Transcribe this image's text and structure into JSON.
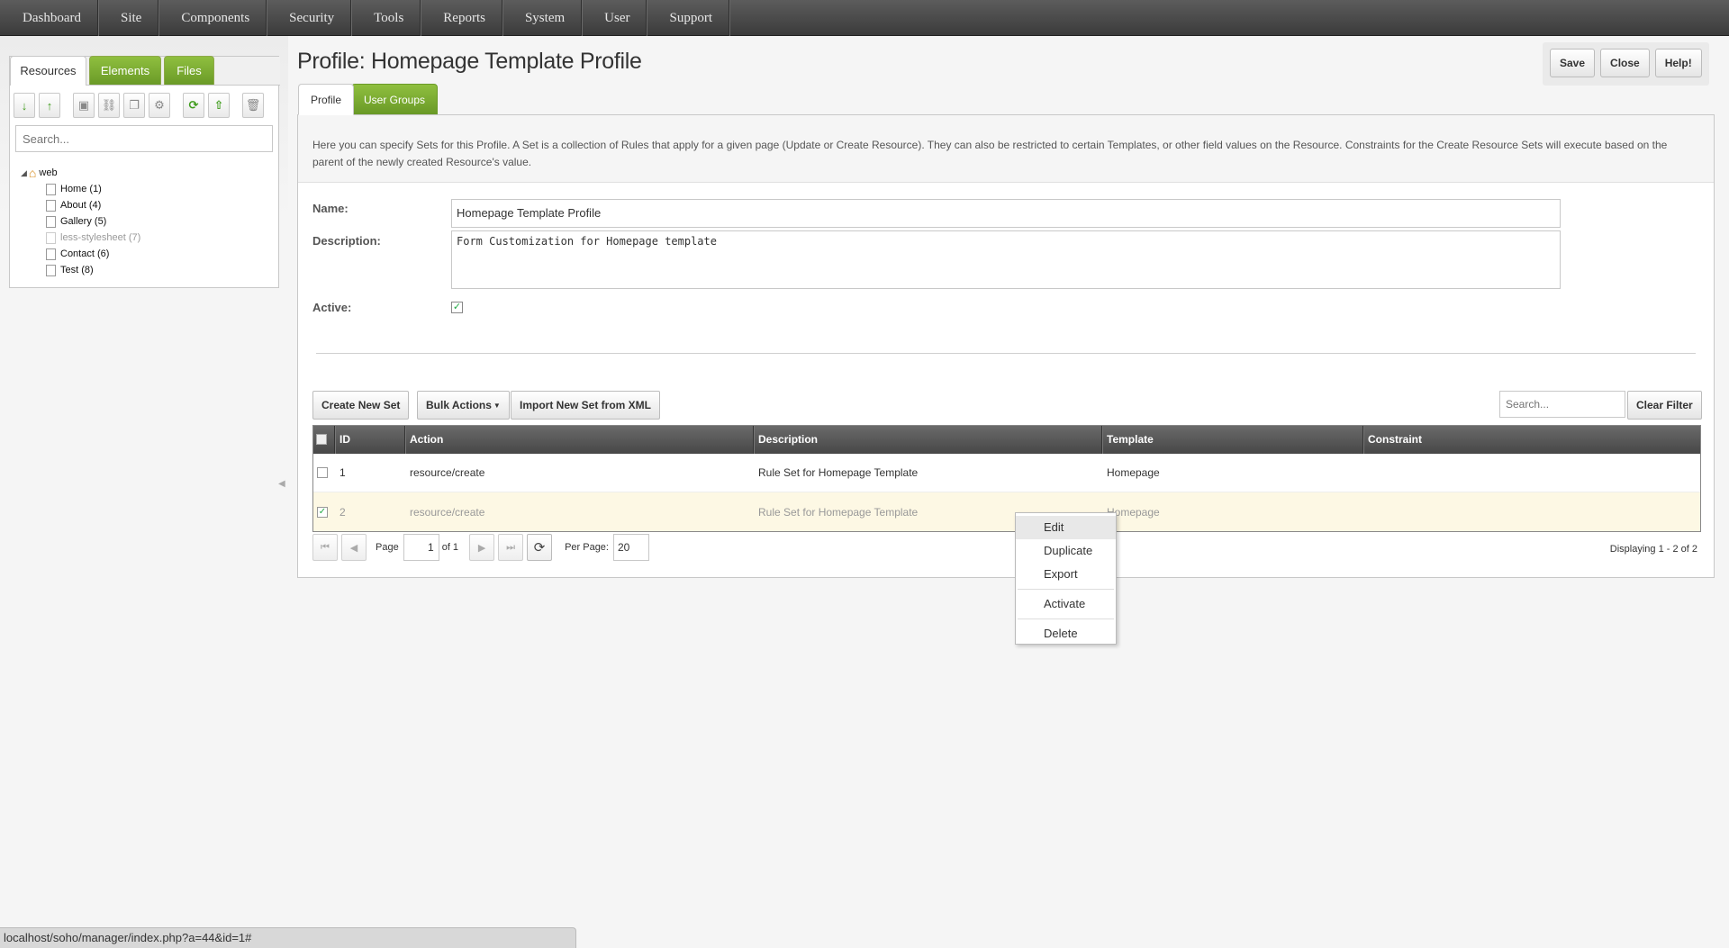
{
  "topnav": [
    "Dashboard",
    "Site",
    "Components",
    "Security",
    "Tools",
    "Reports",
    "System",
    "User",
    "Support"
  ],
  "left": {
    "tabs": [
      "Resources",
      "Elements",
      "Files"
    ],
    "search_placeholder": "Search...",
    "tree": {
      "root": "web",
      "children": [
        {
          "label": "Home",
          "id": "(1)",
          "hidden": false
        },
        {
          "label": "About",
          "id": "(4)",
          "hidden": false
        },
        {
          "label": "Gallery",
          "id": "(5)",
          "hidden": false
        },
        {
          "label": "less-stylesheet",
          "id": "(7)",
          "hidden": true
        },
        {
          "label": "Contact",
          "id": "(6)",
          "hidden": false
        },
        {
          "label": "Test",
          "id": "(8)",
          "hidden": false
        }
      ]
    }
  },
  "page": {
    "title": "Profile: Homepage Template Profile",
    "buttons": {
      "save": "Save",
      "close": "Close",
      "help": "Help!"
    },
    "tabs": [
      "Profile",
      "User Groups"
    ],
    "description": "Here you can specify Sets for this Profile. A Set is a collection of Rules that apply for a given page (Update or Create Resource). They can also be restricted to certain Templates, or other field values on the Resource. Constraints for the Create Resource Sets will execute based on the parent of the newly created Resource's value.",
    "form": {
      "name_label": "Name:",
      "name_value": "Homepage Template Profile",
      "desc_label": "Description:",
      "desc_value": "Form Customization for Homepage template",
      "active_label": "Active:",
      "active": true
    }
  },
  "grid": {
    "buttons": {
      "create": "Create New Set",
      "bulk": "Bulk Actions",
      "import": "Import New Set from XML",
      "clear": "Clear Filter"
    },
    "search_placeholder": "Search...",
    "columns": [
      "ID",
      "Action",
      "Description",
      "Template",
      "Constraint"
    ],
    "rows": [
      {
        "id": "1",
        "action": "resource/create",
        "description": "Rule Set for Homepage Template",
        "template": "Homepage",
        "constraint": "",
        "checked": false
      },
      {
        "id": "2",
        "action": "resource/create",
        "description": "Rule Set for Homepage Template",
        "template": "Homepage",
        "constraint": "",
        "checked": true
      }
    ],
    "pager": {
      "page_label": "Page",
      "page": "1",
      "of": "of 1",
      "per_page_label": "Per Page:",
      "per_page": "20",
      "displaying": "Displaying 1 - 2 of 2"
    }
  },
  "context_menu": [
    "Edit",
    "Duplicate",
    "Export",
    "Activate",
    "Delete"
  ],
  "statusbar": "localhost/soho/manager/index.php?a=44&id=1#"
}
